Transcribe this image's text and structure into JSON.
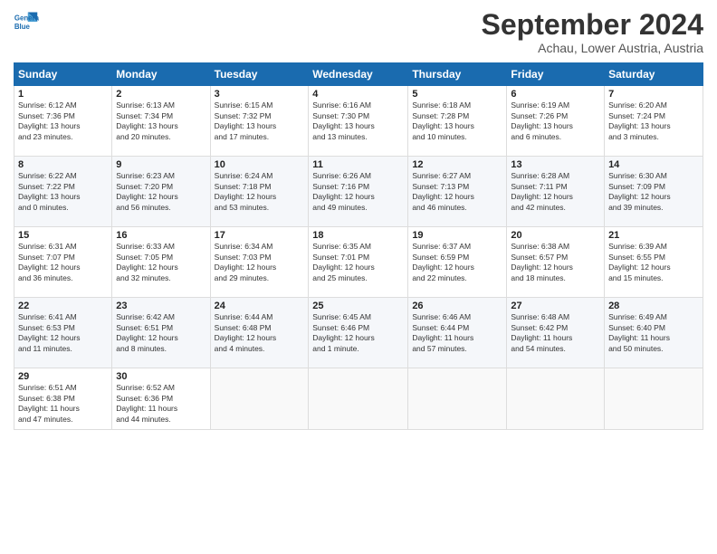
{
  "header": {
    "logo_line1": "General",
    "logo_line2": "Blue",
    "month": "September 2024",
    "location": "Achau, Lower Austria, Austria"
  },
  "weekdays": [
    "Sunday",
    "Monday",
    "Tuesday",
    "Wednesday",
    "Thursday",
    "Friday",
    "Saturday"
  ],
  "weeks": [
    [
      {
        "day": "1",
        "info": "Sunrise: 6:12 AM\nSunset: 7:36 PM\nDaylight: 13 hours\nand 23 minutes."
      },
      {
        "day": "2",
        "info": "Sunrise: 6:13 AM\nSunset: 7:34 PM\nDaylight: 13 hours\nand 20 minutes."
      },
      {
        "day": "3",
        "info": "Sunrise: 6:15 AM\nSunset: 7:32 PM\nDaylight: 13 hours\nand 17 minutes."
      },
      {
        "day": "4",
        "info": "Sunrise: 6:16 AM\nSunset: 7:30 PM\nDaylight: 13 hours\nand 13 minutes."
      },
      {
        "day": "5",
        "info": "Sunrise: 6:18 AM\nSunset: 7:28 PM\nDaylight: 13 hours\nand 10 minutes."
      },
      {
        "day": "6",
        "info": "Sunrise: 6:19 AM\nSunset: 7:26 PM\nDaylight: 13 hours\nand 6 minutes."
      },
      {
        "day": "7",
        "info": "Sunrise: 6:20 AM\nSunset: 7:24 PM\nDaylight: 13 hours\nand 3 minutes."
      }
    ],
    [
      {
        "day": "8",
        "info": "Sunrise: 6:22 AM\nSunset: 7:22 PM\nDaylight: 13 hours\nand 0 minutes."
      },
      {
        "day": "9",
        "info": "Sunrise: 6:23 AM\nSunset: 7:20 PM\nDaylight: 12 hours\nand 56 minutes."
      },
      {
        "day": "10",
        "info": "Sunrise: 6:24 AM\nSunset: 7:18 PM\nDaylight: 12 hours\nand 53 minutes."
      },
      {
        "day": "11",
        "info": "Sunrise: 6:26 AM\nSunset: 7:16 PM\nDaylight: 12 hours\nand 49 minutes."
      },
      {
        "day": "12",
        "info": "Sunrise: 6:27 AM\nSunset: 7:13 PM\nDaylight: 12 hours\nand 46 minutes."
      },
      {
        "day": "13",
        "info": "Sunrise: 6:28 AM\nSunset: 7:11 PM\nDaylight: 12 hours\nand 42 minutes."
      },
      {
        "day": "14",
        "info": "Sunrise: 6:30 AM\nSunset: 7:09 PM\nDaylight: 12 hours\nand 39 minutes."
      }
    ],
    [
      {
        "day": "15",
        "info": "Sunrise: 6:31 AM\nSunset: 7:07 PM\nDaylight: 12 hours\nand 36 minutes."
      },
      {
        "day": "16",
        "info": "Sunrise: 6:33 AM\nSunset: 7:05 PM\nDaylight: 12 hours\nand 32 minutes."
      },
      {
        "day": "17",
        "info": "Sunrise: 6:34 AM\nSunset: 7:03 PM\nDaylight: 12 hours\nand 29 minutes."
      },
      {
        "day": "18",
        "info": "Sunrise: 6:35 AM\nSunset: 7:01 PM\nDaylight: 12 hours\nand 25 minutes."
      },
      {
        "day": "19",
        "info": "Sunrise: 6:37 AM\nSunset: 6:59 PM\nDaylight: 12 hours\nand 22 minutes."
      },
      {
        "day": "20",
        "info": "Sunrise: 6:38 AM\nSunset: 6:57 PM\nDaylight: 12 hours\nand 18 minutes."
      },
      {
        "day": "21",
        "info": "Sunrise: 6:39 AM\nSunset: 6:55 PM\nDaylight: 12 hours\nand 15 minutes."
      }
    ],
    [
      {
        "day": "22",
        "info": "Sunrise: 6:41 AM\nSunset: 6:53 PM\nDaylight: 12 hours\nand 11 minutes."
      },
      {
        "day": "23",
        "info": "Sunrise: 6:42 AM\nSunset: 6:51 PM\nDaylight: 12 hours\nand 8 minutes."
      },
      {
        "day": "24",
        "info": "Sunrise: 6:44 AM\nSunset: 6:48 PM\nDaylight: 12 hours\nand 4 minutes."
      },
      {
        "day": "25",
        "info": "Sunrise: 6:45 AM\nSunset: 6:46 PM\nDaylight: 12 hours\nand 1 minute."
      },
      {
        "day": "26",
        "info": "Sunrise: 6:46 AM\nSunset: 6:44 PM\nDaylight: 11 hours\nand 57 minutes."
      },
      {
        "day": "27",
        "info": "Sunrise: 6:48 AM\nSunset: 6:42 PM\nDaylight: 11 hours\nand 54 minutes."
      },
      {
        "day": "28",
        "info": "Sunrise: 6:49 AM\nSunset: 6:40 PM\nDaylight: 11 hours\nand 50 minutes."
      }
    ],
    [
      {
        "day": "29",
        "info": "Sunrise: 6:51 AM\nSunset: 6:38 PM\nDaylight: 11 hours\nand 47 minutes."
      },
      {
        "day": "30",
        "info": "Sunrise: 6:52 AM\nSunset: 6:36 PM\nDaylight: 11 hours\nand 44 minutes."
      },
      {
        "day": "",
        "info": ""
      },
      {
        "day": "",
        "info": ""
      },
      {
        "day": "",
        "info": ""
      },
      {
        "day": "",
        "info": ""
      },
      {
        "day": "",
        "info": ""
      }
    ]
  ]
}
